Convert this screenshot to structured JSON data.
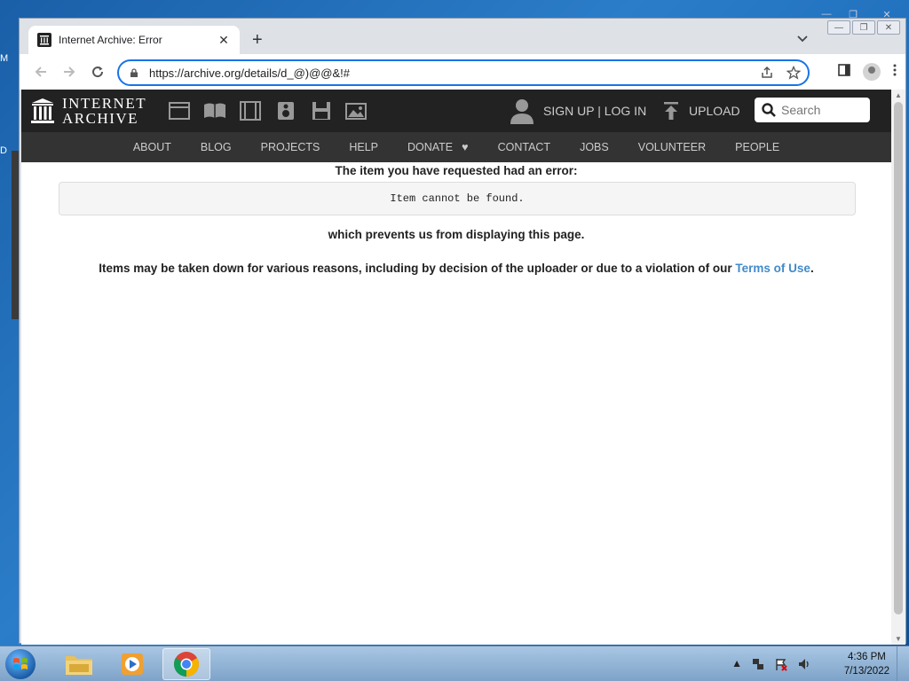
{
  "desktop": {
    "frag_top": "M",
    "frag_mid": "D"
  },
  "tab": {
    "title": "Internet Archive: Error",
    "close": "✕",
    "new": "+"
  },
  "window_controls": {
    "minimize": "—",
    "maximize": "❐",
    "close": "✕"
  },
  "address": {
    "url": "https://archive.org/details/d_@)@@&!#"
  },
  "ia": {
    "logo_line1": "INTERNET",
    "logo_line2": "ARCHIVE",
    "signup": "SIGN UP | LOG IN",
    "upload": "UPLOAD",
    "search_placeholder": "Search",
    "nav": [
      "ABOUT",
      "BLOG",
      "PROJECTS",
      "HELP",
      "DONATE",
      "CONTACT",
      "JOBS",
      "VOLUNTEER",
      "PEOPLE"
    ]
  },
  "error": {
    "heading": "The item you have requested had an error:",
    "message": "Item cannot be found.",
    "sub": "which prevents us from displaying this page.",
    "note": "Items may be taken down for various reasons, including by decision of the uploader or due to a violation of our",
    "link": "Terms of Use",
    "note_end": "."
  },
  "taskbar": {
    "time": "4:36 PM",
    "date": "7/13/2022"
  },
  "colors": {
    "accent": "#1a73e8",
    "ia_bar": "#222222",
    "ia_nav": "#333333",
    "link": "#428bca",
    "heart": "#ee1111"
  }
}
